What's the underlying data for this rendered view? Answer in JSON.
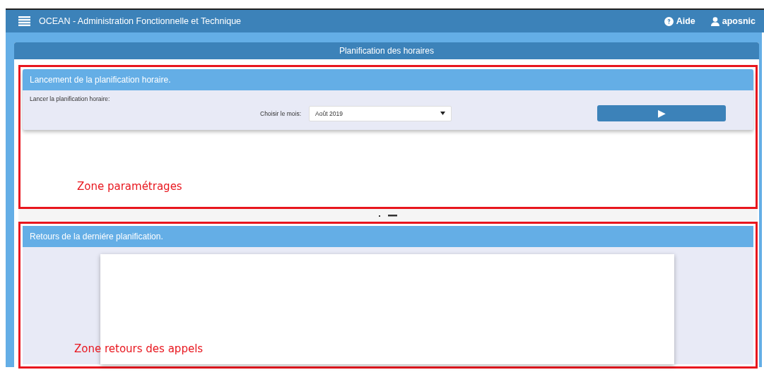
{
  "app_bar": {
    "title": "OCEAN - Administration Fonctionnelle et Technique",
    "help": "Aide",
    "user": "aposnic"
  },
  "page_title": "Planification des horaires",
  "launch_panel": {
    "title": "Lancement de la planification horaire.",
    "intro": "Lancer la planification horaire:",
    "month_label": "Choisir le mois:",
    "month_value": "Août 2019",
    "run_button": "▶"
  },
  "results_panel": {
    "title": "Retours de la derniére planification."
  },
  "annotations": [
    {
      "label": "Zone paramétrages"
    },
    {
      "label": "Zone retours des appels"
    }
  ]
}
